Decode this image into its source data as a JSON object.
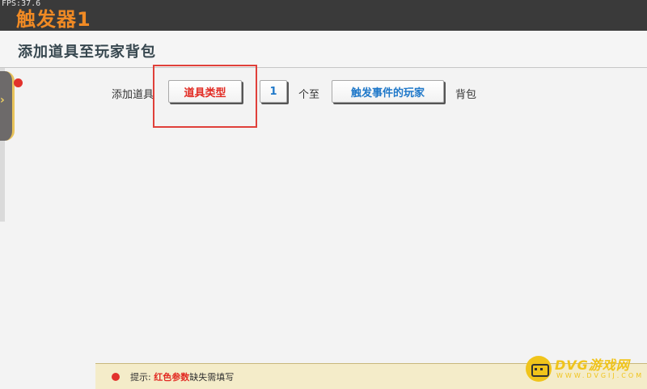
{
  "fps_text": "FPS:37.6",
  "window_title": "触发器1",
  "page_title": "添加道具至玩家背包",
  "action_row": {
    "prefix": "添加道具",
    "item_type_button": "道具类型",
    "count_button": "1",
    "middle_text": "个至",
    "player_button": "触发事件的玩家",
    "suffix": "背包"
  },
  "hint": {
    "prefix": "提示:",
    "red_text": "红色参数",
    "suffix": "缺失需填写"
  },
  "watermark": {
    "name": "DVG游戏网",
    "url": "WWW.DVGIJ.COM"
  },
  "colors": {
    "accent_orange": "#f08a24",
    "param_red": "#e22b23",
    "param_blue": "#1f78c9",
    "hint_bg": "#f4ecc9",
    "title_bar": "#3a3a3a"
  }
}
